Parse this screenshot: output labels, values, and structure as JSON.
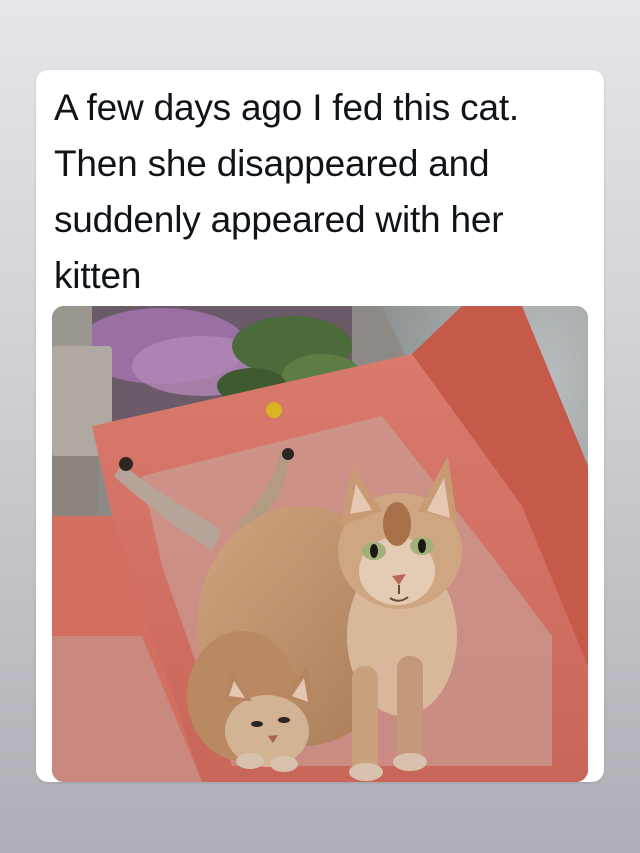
{
  "post": {
    "text": "A few days ago I fed this cat. Then she disappeared and suddenly appeared with her kitten"
  },
  "photo": {
    "subject": "adult cat with kitten on red steps"
  },
  "colors": {
    "page_background": "#d3d3d8",
    "card_background": "#ffffff",
    "text": "#0f1419",
    "step_red": "#d2695a",
    "cat_fur": "#c49a73"
  }
}
